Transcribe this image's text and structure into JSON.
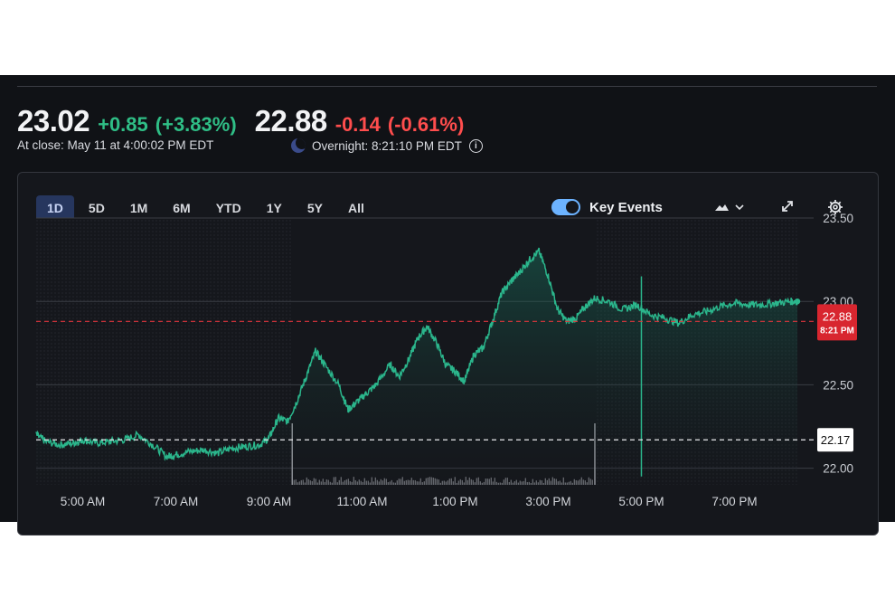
{
  "quote": {
    "close_price": "23.02",
    "close_change": "+0.85",
    "close_change_pct": "(+3.83%)",
    "overnight_price": "22.88",
    "overnight_change": "-0.14",
    "overnight_change_pct": "(-0.61%)",
    "close_label": "At close: May 11 at 4:00:02 PM EDT",
    "overnight_label": "Overnight: 8:21:10 PM EDT"
  },
  "tabs": [
    "1D",
    "5D",
    "1M",
    "6M",
    "YTD",
    "1Y",
    "5Y",
    "All"
  ],
  "active_tab": "1D",
  "key_events_label": "Key Events",
  "icons": {
    "chart_type": "mountain-chart-icon",
    "expand": "expand-icon",
    "settings": "gear-icon",
    "overnight": "moon-icon",
    "info": "info-icon"
  },
  "colors": {
    "line": "#2bb68c",
    "positive": "#2fbe86",
    "negative": "#ff4d4d",
    "current_label_bg": "#d8262f"
  },
  "chart_data": {
    "type": "area",
    "x_label": "",
    "y_label": "",
    "ylim": [
      21.9,
      23.5
    ],
    "y_ticks": [
      "23.50",
      "23.00",
      "22.50",
      "22.00"
    ],
    "x_ticks": [
      "5:00 AM",
      "7:00 AM",
      "9:00 AM",
      "11:00 AM",
      "1:00 PM",
      "3:00 PM",
      "5:00 PM",
      "7:00 PM"
    ],
    "x_tick_hours": [
      5,
      7,
      9,
      11,
      13,
      15,
      17,
      19
    ],
    "x_range_hours": [
      4,
      20.35
    ],
    "regular_session_hours": [
      9.5,
      16
    ],
    "previous_close": "22.17",
    "current_price": "22.88",
    "current_time": "8:21 PM",
    "series": [
      {
        "x": [
          4.0,
          4.2,
          4.5,
          4.8,
          5.0,
          5.3,
          5.6,
          5.9,
          6.2,
          6.5,
          6.8,
          7.0,
          7.3,
          7.6,
          7.9,
          8.2,
          8.5,
          8.8,
          9.0,
          9.2,
          9.4,
          9.6,
          9.8,
          10.0,
          10.2,
          10.5,
          10.7,
          10.9,
          11.1,
          11.3,
          11.6,
          11.8,
          12.0,
          12.2,
          12.4,
          12.6,
          12.8,
          13.0,
          13.2,
          13.4,
          13.6,
          13.8,
          14.0,
          14.2,
          14.4,
          14.6,
          14.8,
          15.0,
          15.2,
          15.4,
          15.6,
          15.8,
          16.0,
          16.3,
          16.6,
          16.9,
          17.2,
          17.5,
          17.8,
          18.1,
          18.4,
          18.7,
          19.0,
          19.3,
          19.6,
          19.9,
          20.2,
          20.35
        ],
        "y": [
          22.2,
          22.16,
          22.14,
          22.15,
          22.17,
          22.15,
          22.16,
          22.17,
          22.2,
          22.14,
          22.07,
          22.08,
          22.1,
          22.11,
          22.09,
          22.12,
          22.13,
          22.14,
          22.18,
          22.3,
          22.28,
          22.4,
          22.55,
          22.7,
          22.62,
          22.5,
          22.35,
          22.4,
          22.45,
          22.5,
          22.62,
          22.55,
          22.65,
          22.78,
          22.85,
          22.75,
          22.62,
          22.58,
          22.52,
          22.68,
          22.72,
          22.88,
          23.05,
          23.12,
          23.18,
          23.25,
          23.3,
          23.15,
          22.95,
          22.88,
          22.9,
          22.97,
          23.02,
          23.0,
          22.95,
          22.98,
          22.92,
          22.9,
          22.87,
          22.92,
          22.94,
          22.97,
          22.99,
          22.98,
          22.98,
          22.99,
          23.0,
          23.0
        ]
      }
    ],
    "volume_spike": {
      "x": 17.0,
      "low": 21.95,
      "high": 23.15
    }
  }
}
